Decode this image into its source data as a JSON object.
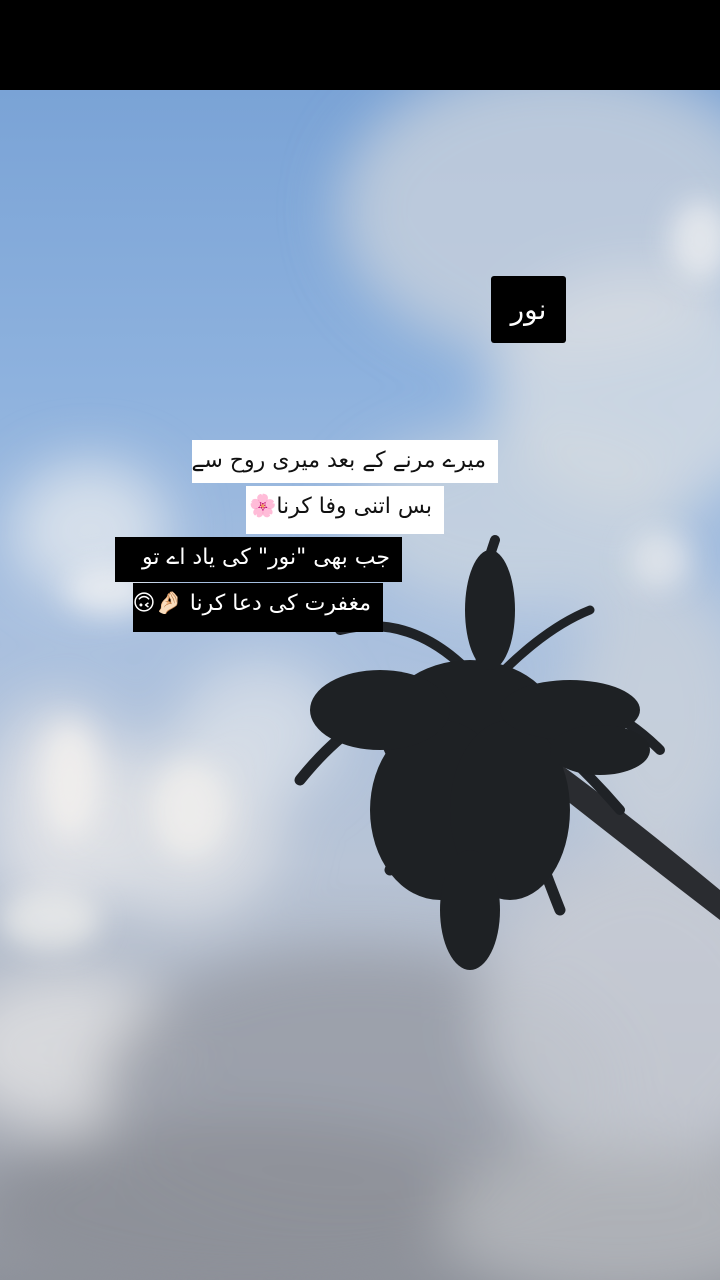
{
  "name_label": "نور",
  "captions": {
    "line1": "میرے مرنے کے بعد میری روح سے",
    "line2": "بس اتنی وفا کرنا🌸",
    "line3": "جب بھی \"نور\" کی یاد اے تو",
    "line4": "مغفرت کی دعا کرنا 🤌🏻🙃"
  },
  "colors": {
    "caption_light_bg": "#ffffff",
    "caption_dark_bg": "#000000",
    "sky": "#8eb2de"
  }
}
